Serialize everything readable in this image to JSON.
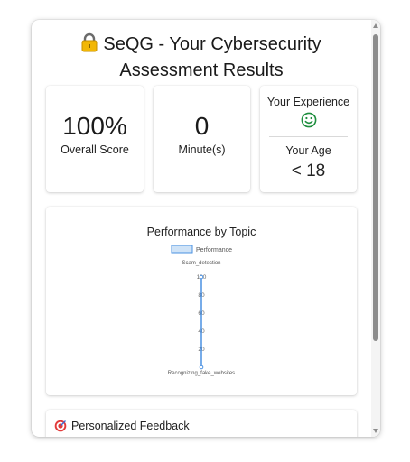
{
  "header": {
    "title_line1": "SeQG - Your Cybersecurity",
    "title_line2": "Assessment Results"
  },
  "stats": {
    "score_value": "100%",
    "score_label": "Overall Score",
    "time_value": "0",
    "time_label": "Minute(s)",
    "experience_label": "Your Experience",
    "experience_icon": "smiley-icon",
    "age_label": "Your Age",
    "age_value": "< 18"
  },
  "chart_data": {
    "type": "radar",
    "title": "Performance by Topic",
    "categories": [
      "Scam_detection",
      "Recognizing_fake_websites"
    ],
    "series": [
      {
        "name": "Performance",
        "values": [
          100,
          0
        ]
      }
    ],
    "radial_ticks": [
      "100",
      "80",
      "60",
      "40",
      "20"
    ],
    "rlim": [
      0,
      100
    ],
    "legend": "top-center",
    "color": "#4a90e2"
  },
  "feedback": {
    "label": "Personalized Feedback",
    "icon": "target-icon"
  }
}
